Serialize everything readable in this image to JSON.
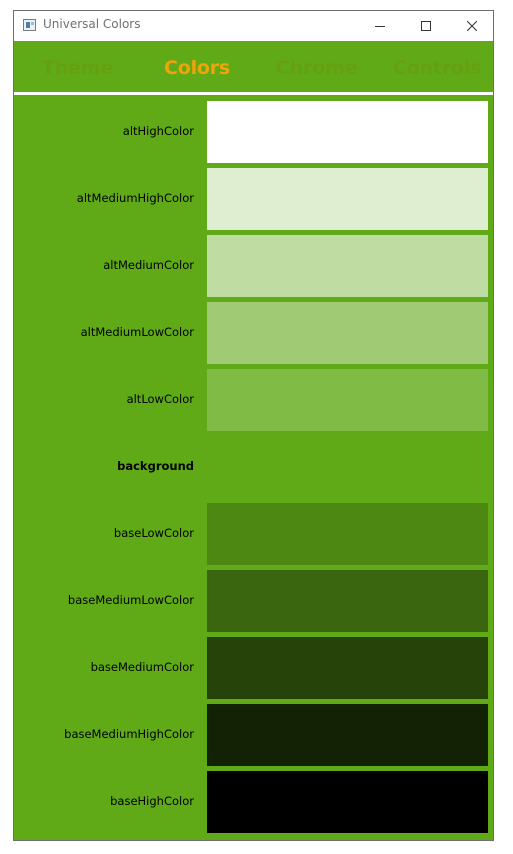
{
  "window": {
    "title": "Universal Colors",
    "minimize_icon": "minimize-icon",
    "maximize_icon": "maximize-icon",
    "close_icon": "close-icon"
  },
  "tabs": [
    {
      "label": "Theme",
      "selected": false
    },
    {
      "label": "Colors",
      "selected": true
    },
    {
      "label": "Chrome",
      "selected": false
    },
    {
      "label": "Controls",
      "selected": false
    }
  ],
  "theme": {
    "accent": "#5faa16",
    "selected_tab_color": "#f0a30a",
    "unselected_tab_color": "#66a010"
  },
  "colors": [
    {
      "name": "altHighColor",
      "color": "#ffffff",
      "bold": false
    },
    {
      "name": "altMediumHighColor",
      "color": "#dfedd0",
      "bold": false
    },
    {
      "name": "altMediumColor",
      "color": "#bfdca2",
      "bold": false
    },
    {
      "name": "altMediumLowColor",
      "color": "#a0cb74",
      "bold": false
    },
    {
      "name": "altLowColor",
      "color": "#80bb46",
      "bold": false
    },
    {
      "name": "background",
      "color": "#5faa16",
      "bold": true
    },
    {
      "name": "baseLowColor",
      "color": "#4c8812",
      "bold": false
    },
    {
      "name": "baseMediumLowColor",
      "color": "#39660e",
      "bold": false
    },
    {
      "name": "baseMediumColor",
      "color": "#264409",
      "bold": false
    },
    {
      "name": "baseMediumHighColor",
      "color": "#132205",
      "bold": false
    },
    {
      "name": "baseHighColor",
      "color": "#000000",
      "bold": false
    }
  ]
}
